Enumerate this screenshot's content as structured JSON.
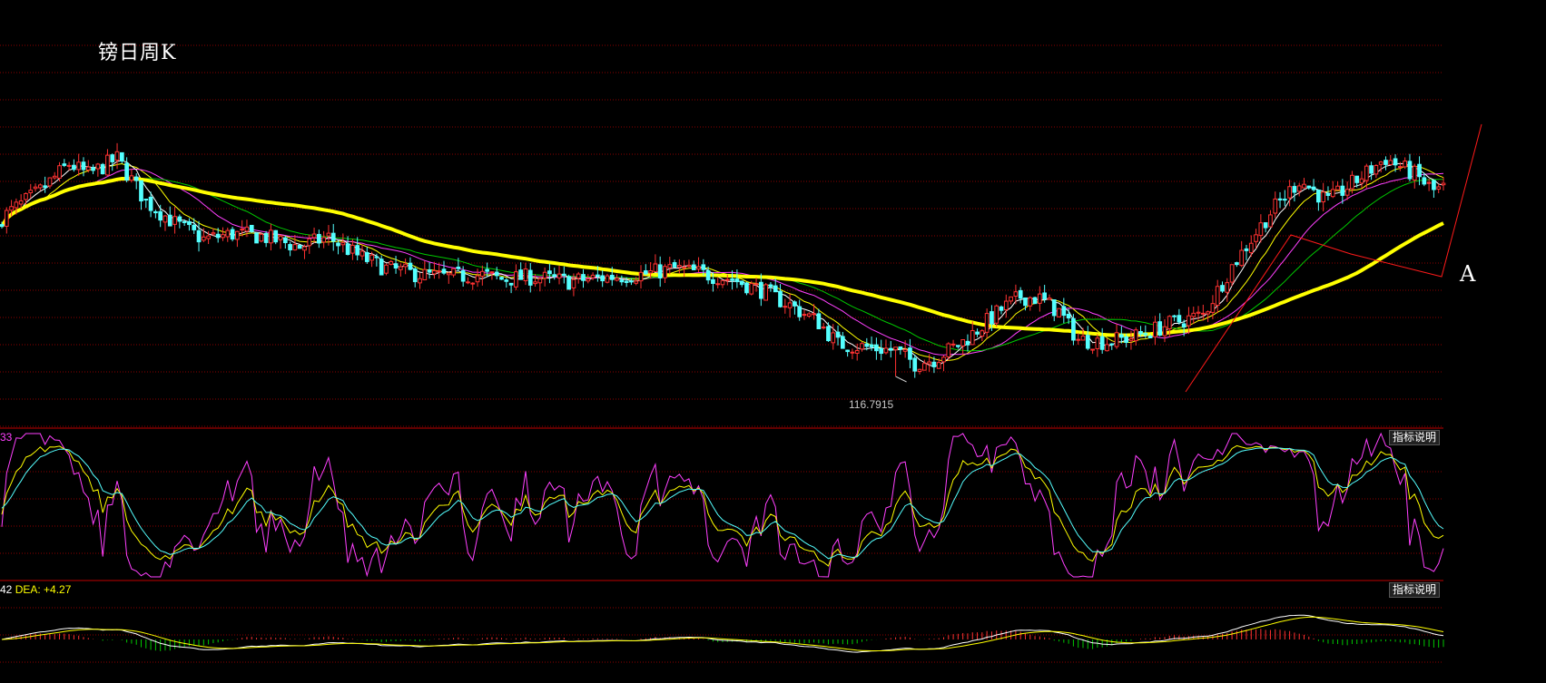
{
  "title": "镑日周K",
  "annotation": "A",
  "min_label": "116.7915",
  "kdj_legend": "33",
  "macd_legend": {
    "dif": "42",
    "dea": "DEA: +4.27"
  },
  "explain_button": "指标说明",
  "colors": {
    "up": "#ff3232",
    "down": "#54ffff",
    "ma5": "#ffffff",
    "ma10": "#ffff00",
    "ma20": "#ff40ff",
    "ma30": "#00c800",
    "ma60": "#ffff00",
    "k": "#ff40ff",
    "d": "#ffff00",
    "j": "#54ffff",
    "grid": "#8b0000"
  },
  "chart_data": {
    "type": "candlestick",
    "price_range": [
      112,
      150
    ],
    "min_point": {
      "value": 116.7915
    },
    "anchors": [
      [
        0,
        131.5
      ],
      [
        8,
        134.0
      ],
      [
        14,
        136.5
      ],
      [
        18,
        135.5
      ],
      [
        24,
        137.0
      ],
      [
        30,
        133.0
      ],
      [
        36,
        131.0
      ],
      [
        42,
        129.5
      ],
      [
        48,
        130.0
      ],
      [
        54,
        129.8
      ],
      [
        62,
        128.8
      ],
      [
        68,
        129.7
      ],
      [
        74,
        128.0
      ],
      [
        80,
        126.8
      ],
      [
        86,
        126.3
      ],
      [
        92,
        126.0
      ],
      [
        100,
        126.2
      ],
      [
        104,
        125.8
      ],
      [
        110,
        126.0
      ],
      [
        118,
        125.6
      ],
      [
        126,
        126.0
      ],
      [
        134,
        126.3
      ],
      [
        140,
        126.8
      ],
      [
        146,
        126.3
      ],
      [
        152,
        125.8
      ],
      [
        158,
        124.8
      ],
      [
        164,
        123.4
      ],
      [
        170,
        121.8
      ],
      [
        174,
        119.8
      ],
      [
        180,
        119.5
      ],
      [
        186,
        119.2
      ],
      [
        190,
        118.0
      ],
      [
        194,
        118.4
      ],
      [
        200,
        120.0
      ],
      [
        208,
        123.0
      ],
      [
        212,
        124.2
      ],
      [
        216,
        124.0
      ],
      [
        220,
        122.8
      ],
      [
        224,
        120.2
      ],
      [
        230,
        120.0
      ],
      [
        236,
        120.5
      ],
      [
        244,
        121.8
      ],
      [
        250,
        122.5
      ],
      [
        256,
        127.0
      ],
      [
        264,
        132.0
      ],
      [
        270,
        135.0
      ],
      [
        276,
        133.0
      ],
      [
        282,
        135.0
      ],
      [
        288,
        137.0
      ],
      [
        294,
        135.5
      ],
      [
        298,
        134.0
      ],
      [
        300,
        134.2
      ]
    ],
    "kdj_series": [
      "K",
      "D",
      "J"
    ],
    "macd_series": [
      "DIF",
      "DEA",
      "MACD"
    ]
  }
}
